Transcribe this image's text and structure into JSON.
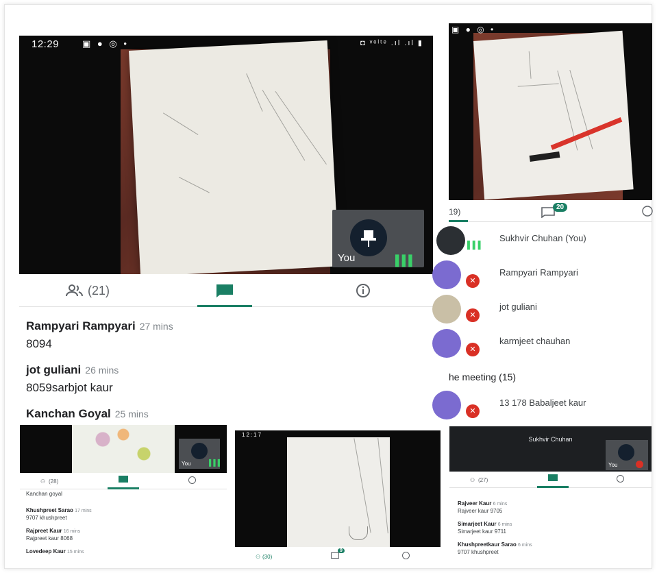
{
  "main": {
    "status_time": "12:29",
    "status_icons": "▣ ● ◎ •",
    "status_right": "◘ ᵛᵒˡᵗᵉ .ıl .ıl ▮",
    "pip_label": "You",
    "participants_tab": "(21)",
    "chat": [
      {
        "name": "Rampyari Rampyari",
        "time": "27 mins",
        "msg": "8094"
      },
      {
        "name": "jot guliani",
        "time": "26 mins",
        "msg": "8059sarbjot kaur"
      },
      {
        "name": "Kanchan Goyal",
        "time": "25 mins",
        "msg": ""
      }
    ]
  },
  "right": {
    "participants_tab": "19)",
    "chat_badge": "20",
    "people": [
      {
        "name": "Sukhvir Chuhan (You)"
      },
      {
        "name": "Rampyari Rampyari"
      },
      {
        "name": "jot guliani"
      },
      {
        "name": "karmjeet chauhan"
      }
    ],
    "section_heading": "he meeting (15)",
    "others": [
      {
        "name": "13 178 Babaljeet kaur"
      }
    ]
  },
  "thumb_a": {
    "pip_label": "You",
    "participants_tab": "(28)",
    "entries": [
      {
        "name": "",
        "time": "",
        "msg": "Kanchan goyal"
      },
      {
        "name": "Khushpreet Sarao",
        "time": "17 mins",
        "msg": "9707 khushpreet"
      },
      {
        "name": "Rajpreet Kaur",
        "time": "16 mins",
        "msg": "Rajpreet kaur 8068"
      },
      {
        "name": "Lovedeep Kaur",
        "time": "15 mins",
        "msg": ""
      }
    ]
  },
  "thumb_b": {
    "status_time": "12:17",
    "participants_tab": "(30)",
    "chat_badge": "9"
  },
  "thumb_c": {
    "video_name": "Sukhvir Chuhan",
    "pip_label": "You",
    "participants_tab": "(27)",
    "entries": [
      {
        "name": "Rajveer Kaur",
        "time": "6 mins",
        "msg": "Rajveer kaur 9705"
      },
      {
        "name": "Simarjeet Kaur",
        "time": "6 mins",
        "msg": "Simarjeet kaur 9711"
      },
      {
        "name": "Khushpreetkaur Sarao",
        "time": "6 mins",
        "msg": "9707 khushpreet"
      }
    ]
  },
  "colors": {
    "accent": "#1a7f64",
    "mute": "#d93025",
    "avatar": "#7b6bd0"
  }
}
